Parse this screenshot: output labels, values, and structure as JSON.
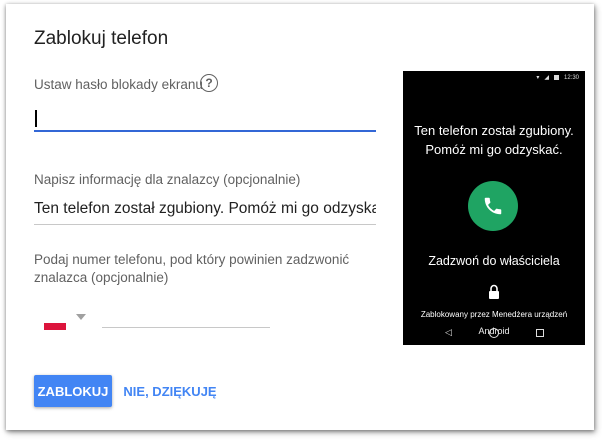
{
  "dialog": {
    "title": "Zablokuj telefon",
    "password_label": "Ustaw hasło blokady ekranu",
    "password_value": "",
    "message_label": "Napisz informację dla znalazcy (opcjonalnie)",
    "message_value": "Ten telefon został zgubiony. Pomóż mi go odzyskać",
    "phone_label": "Podaj numer telefonu, pod który powinien zadzwonić znalazca (opcjonalnie)",
    "phone_value": "",
    "lock_button": "ZABLOKUJ",
    "decline_button": "NIE, DZIĘKUJĘ",
    "help_icon": "help-circle-icon",
    "country_flag": "poland-flag"
  },
  "phone_preview": {
    "status_time": "12:30",
    "message_line1": "Ten telefon został zgubiony.",
    "message_line2": "Pomóż mi go odzyskać.",
    "call_label": "Zadzwoń do właściciela",
    "locked_by": "Zablokowany przez Menedżera urządzeń",
    "os_label": "Android"
  },
  "colors": {
    "accent": "#4285f4",
    "input_focus": "#3367d6",
    "call_green": "#1fa463",
    "flag_red": "#dc143c"
  }
}
